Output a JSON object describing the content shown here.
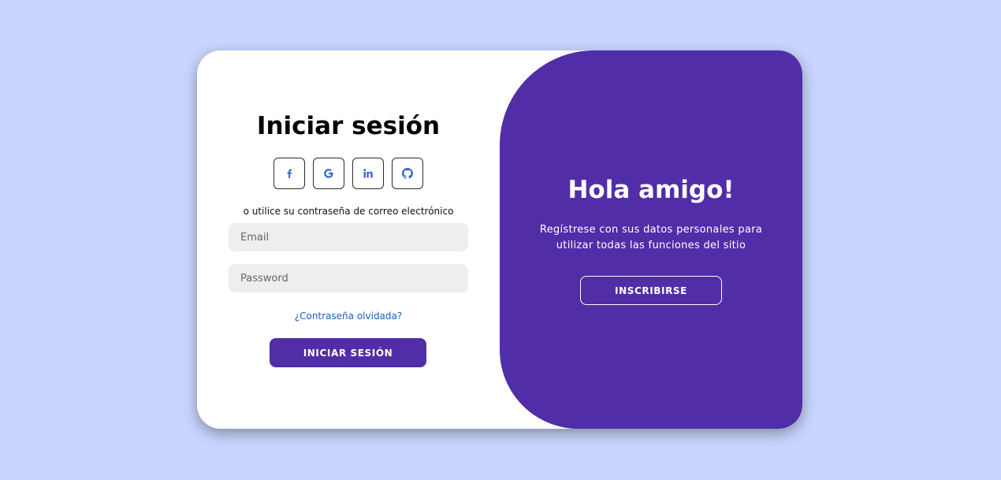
{
  "signin": {
    "title": "Iniciar sesión",
    "social": [
      {
        "name": "facebook-icon",
        "glyph": "f"
      },
      {
        "name": "google-icon",
        "glyph": "G"
      },
      {
        "name": "linkedin-icon",
        "glyph": "in"
      },
      {
        "name": "github-icon",
        "glyph": "github"
      }
    ],
    "alt_text": "o utilice su contraseña de correo electrónico",
    "email_placeholder": "Email",
    "password_placeholder": "Password",
    "forgot_label": "¿Contraseña olvidada?",
    "button_label": "INICIAR SESIÓN"
  },
  "panel": {
    "title": "Hola amigo!",
    "text": "Regístrese con sus datos personales para utilizar todas las funciones del sitio",
    "button_label": "INSCRIBIRSE"
  },
  "colors": {
    "background": "#c9d5fe",
    "accent": "#512da8",
    "icon": "#3a67c9",
    "link": "#1a5fb4"
  }
}
